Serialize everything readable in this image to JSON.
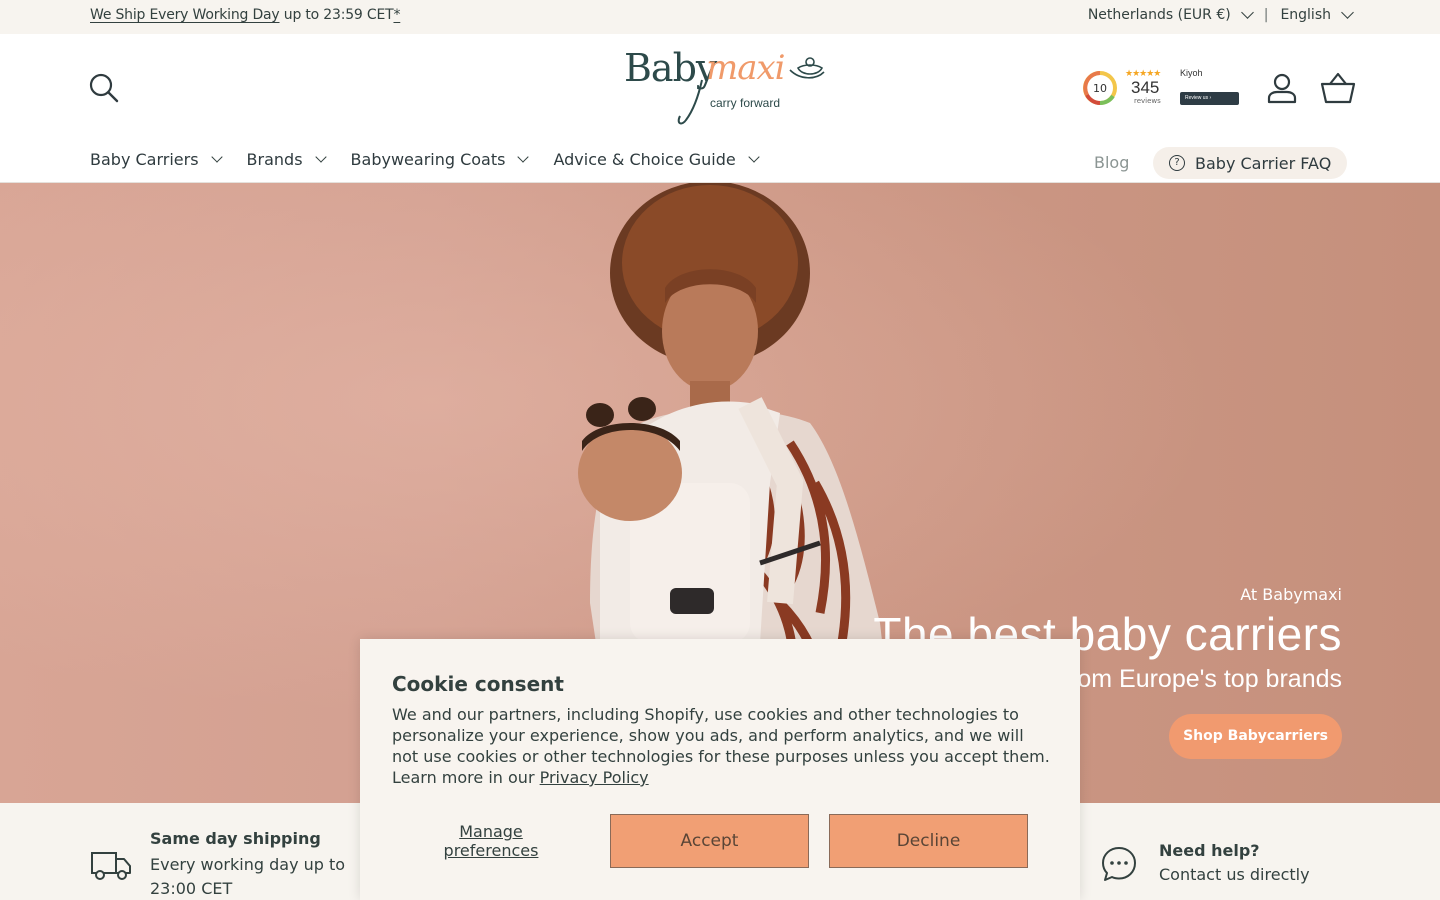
{
  "announcement": {
    "ship_link": "We Ship Every Working Day",
    "ship_rest": "up to 23:59 CET",
    "ship_asterisk": "*",
    "country": "Netherlands (EUR €)",
    "separator": "|",
    "language": "English"
  },
  "header": {
    "logo": {
      "brand_a": "Baby",
      "brand_b": "maxi",
      "tagline": "carry forward"
    },
    "reviews": {
      "score": "10",
      "count": "345",
      "count_label": "reviews",
      "provider": "Kiyoh",
      "button": "Review us"
    },
    "nav": [
      {
        "label": "Baby Carriers"
      },
      {
        "label": "Brands"
      },
      {
        "label": "Babywearing Coats"
      },
      {
        "label": "Advice & Choice Guide"
      }
    ],
    "blog": "Blog",
    "faq": "Baby Carrier FAQ"
  },
  "hero": {
    "eyebrow": "At Babymaxi",
    "title": "The best baby carriers",
    "subtitle": "from Europe's top brands",
    "cta": "Shop Babycarriers"
  },
  "usp": {
    "shipping_title": "Same day shipping",
    "shipping_text": "Every working day up to 23:00 CET",
    "help_title": "Need help?",
    "help_text": "Contact us directly"
  },
  "cookie": {
    "title": "Cookie consent",
    "body": "We and our partners, including Shopify, use cookies and other technologies to personalize your experience, show you ads, and perform analytics, and we will not use cookies or other technologies for these purposes unless you accept them. Learn more in our",
    "policy_link": "Privacy Policy",
    "manage": "Manage preferences",
    "accept": "Accept",
    "decline": "Decline"
  },
  "colors": {
    "accent": "#f19a6f",
    "ink": "#33413f",
    "cream": "#f7f4ef",
    "hero_bg": "#d3a091"
  },
  "icons": [
    "search-icon",
    "account-icon",
    "cart-icon",
    "chevron-down-icon",
    "question-icon",
    "truck-icon",
    "chat-icon"
  ]
}
